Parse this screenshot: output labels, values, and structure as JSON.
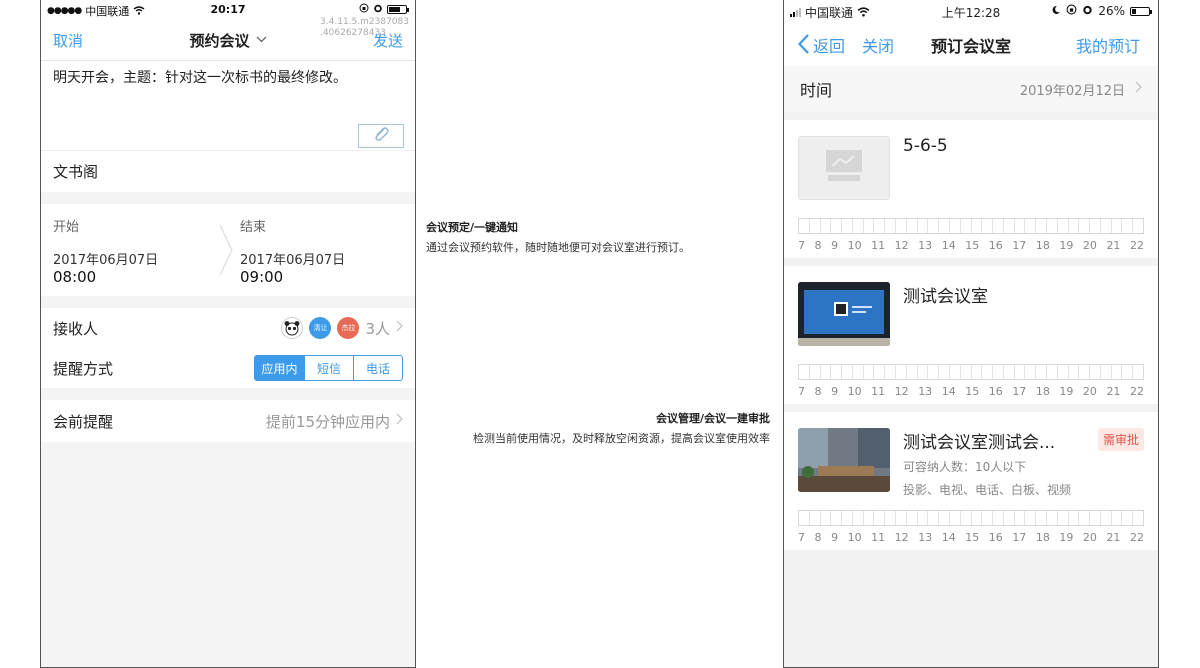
{
  "left_phone": {
    "status": {
      "signal_dots": "●●●●●",
      "carrier": "中国联通",
      "time": "20:17",
      "battery_level": 0.7
    },
    "version": [
      "3.4.11.5.m2387083",
      ".40626278433"
    ],
    "nav": {
      "cancel": "取消",
      "title": "预约会议",
      "send": "发送"
    },
    "body_text": "明天开会，主题：针对这一次标书的最终修改。",
    "author": "文书阁",
    "start": {
      "label": "开始",
      "date": "2017年06月07日",
      "time": "08:00"
    },
    "end": {
      "label": "结束",
      "date": "2017年06月07日",
      "time": "09:00"
    },
    "recipients": {
      "label": "接收人",
      "avatar_a": "清让",
      "avatar_b": "杰拉",
      "count": "3人"
    },
    "reminder_method": {
      "label": "提醒方式",
      "options": [
        "应用内",
        "短信",
        "电话"
      ],
      "selected": "应用内"
    },
    "pre_reminder": {
      "label": "会前提醒",
      "value": "提前15分钟应用内"
    }
  },
  "features": [
    {
      "title": "会议预定/一键通知",
      "desc": "通过会议预约软件，随时随地便可对会议室进行预订。"
    },
    {
      "title": "会议管理/会议一建审批",
      "desc": "检测当前使用情况，及时释放空闲资源，提高会议室使用效率"
    }
  ],
  "right_phone": {
    "status": {
      "carrier": "中国联通",
      "time": "上午12:28",
      "battery": "26%",
      "battery_level": 0.26
    },
    "nav": {
      "back": "返回",
      "close": "关闭",
      "title": "预订会议室",
      "mine": "我的预订"
    },
    "time_row": {
      "label": "时间",
      "date": "2019年02月12日"
    },
    "hours": [
      "7",
      "8",
      "9",
      "10",
      "11",
      "12",
      "13",
      "14",
      "15",
      "16",
      "17",
      "18",
      "19",
      "20",
      "21",
      "22"
    ],
    "rooms": [
      {
        "name": "5-6-5",
        "capacity": "",
        "equipment": "",
        "badge": "",
        "thumb": "placeholder"
      },
      {
        "name": "测试会议室",
        "capacity": "",
        "equipment": "",
        "badge": "",
        "thumb": "screen"
      },
      {
        "name": "测试会议室测试会...",
        "capacity": "可容纳人数：10人以下",
        "equipment": "投影、电视、电话、白板、视频",
        "badge": "需审批",
        "thumb": "office"
      }
    ]
  },
  "colors": {
    "accent": "#3d9be9",
    "badge_bg": "#fde8e4",
    "badge_text": "#e0554a"
  }
}
